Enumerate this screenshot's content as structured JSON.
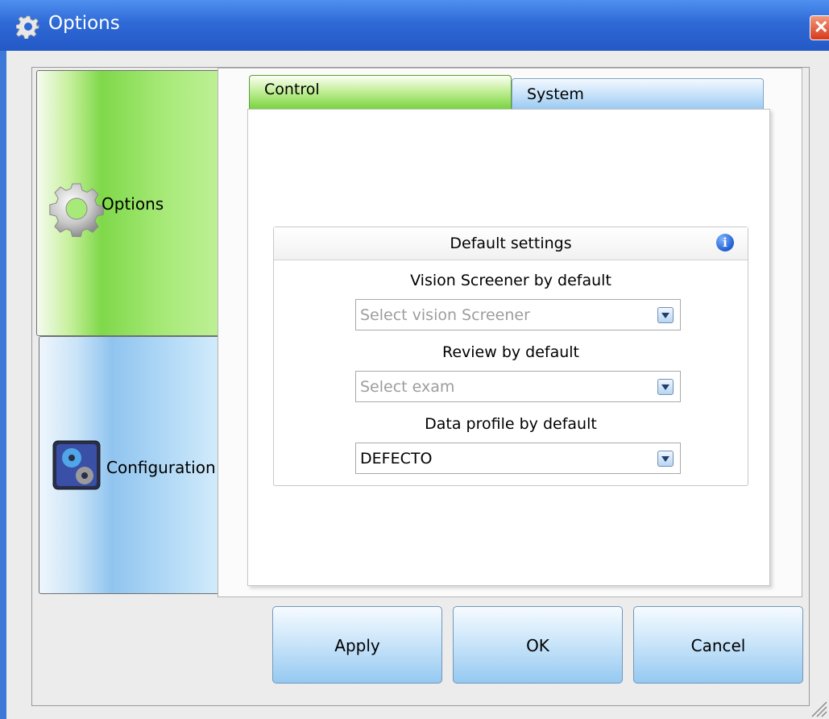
{
  "window": {
    "title": "Options",
    "title_icon": "gear-icon",
    "close_glyph": "✕"
  },
  "nav": {
    "items": [
      {
        "label": "Options",
        "icon": "gear-icon",
        "active": true
      },
      {
        "label": "Configuration",
        "icon": "configuration-gears-icon",
        "active": false
      }
    ]
  },
  "tabs": [
    {
      "label": "Control",
      "active": true
    },
    {
      "label": "System",
      "active": false
    }
  ],
  "group": {
    "title": "Default settings",
    "info_icon": "info-icon",
    "fields": [
      {
        "label": "Vision Screener by default",
        "value": "",
        "placeholder": "Select vision Screener"
      },
      {
        "label": "Review by default",
        "value": "",
        "placeholder": "Select exam"
      },
      {
        "label": "Data profile by default",
        "value": "DEFECTO",
        "placeholder": ""
      }
    ]
  },
  "buttons": {
    "apply": "Apply",
    "ok": "OK",
    "cancel": "Cancel"
  },
  "colors": {
    "titlebar": "#2e69d6",
    "active_green": "#7fd84a",
    "inactive_blue": "#90c4ef"
  }
}
